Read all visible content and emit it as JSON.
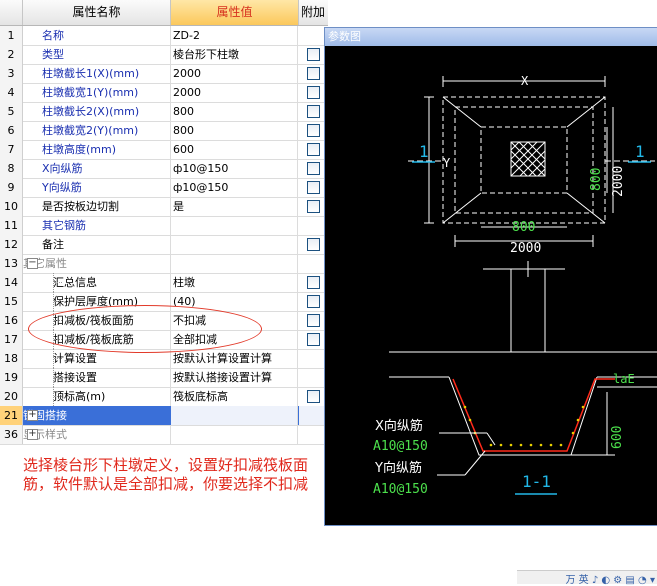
{
  "header": {
    "col_name": "属性名称",
    "col_value": "属性值",
    "col_add": "附加"
  },
  "rows": [
    {
      "num": "1",
      "name": "名称",
      "value": "ZD-2",
      "style": "blue",
      "checkbox": false
    },
    {
      "num": "2",
      "name": "类型",
      "value": "棱台形下柱墩",
      "style": "blue",
      "checkbox": true
    },
    {
      "num": "3",
      "name": "柱墩截长1(X)(mm)",
      "value": "2000",
      "style": "blue",
      "checkbox": true
    },
    {
      "num": "4",
      "name": "柱墩截宽1(Y)(mm)",
      "value": "2000",
      "style": "blue",
      "checkbox": true
    },
    {
      "num": "5",
      "name": "柱墩截长2(X)(mm)",
      "value": "800",
      "style": "blue",
      "checkbox": true
    },
    {
      "num": "6",
      "name": "柱墩截宽2(Y)(mm)",
      "value": "800",
      "style": "blue",
      "checkbox": true
    },
    {
      "num": "7",
      "name": "柱墩高度(mm)",
      "value": "600",
      "style": "blue",
      "checkbox": true
    },
    {
      "num": "8",
      "name": "X向纵筋",
      "value": "ф10@150",
      "style": "blue",
      "checkbox": true
    },
    {
      "num": "9",
      "name": "Y向纵筋",
      "value": "ф10@150",
      "style": "blue",
      "checkbox": true
    },
    {
      "num": "10",
      "name": "是否按板边切割",
      "value": "是",
      "style": "plain",
      "checkbox": true
    },
    {
      "num": "11",
      "name": "其它钢筋",
      "value": "",
      "style": "blue",
      "checkbox": false
    },
    {
      "num": "12",
      "name": "备注",
      "value": "",
      "style": "plain",
      "checkbox": true
    },
    {
      "num": "13",
      "name": "其它属性",
      "value": "",
      "style": "group",
      "toggle": "−",
      "checkbox": false
    },
    {
      "num": "14",
      "name": "汇总信息",
      "value": "柱墩",
      "style": "sub",
      "checkbox": true
    },
    {
      "num": "15",
      "name": "保护层厚度(mm)",
      "value": "(40)",
      "style": "sub",
      "checkbox": true
    },
    {
      "num": "16",
      "name": "扣减板/筏板面筋",
      "value": "不扣减",
      "style": "sub",
      "checkbox": true
    },
    {
      "num": "17",
      "name": "扣减板/筏板底筋",
      "value": "全部扣减",
      "style": "sub",
      "checkbox": true
    },
    {
      "num": "18",
      "name": "计算设置",
      "value": "按默认计算设置计算",
      "style": "sub",
      "checkbox": false
    },
    {
      "num": "19",
      "name": "搭接设置",
      "value": "按默认搭接设置计算",
      "style": "sub",
      "checkbox": false
    },
    {
      "num": "20",
      "name": "顶标高(m)",
      "value": "筏板底标高",
      "style": "sub",
      "checkbox": true
    },
    {
      "num": "21",
      "name": "锚固搭接",
      "value": "",
      "style": "selected",
      "toggle": "+",
      "checkbox": false
    },
    {
      "num": "36",
      "name": "显示样式",
      "value": "",
      "style": "group",
      "toggle": "+",
      "checkbox": false
    }
  ],
  "panel": {
    "title": "参数图"
  },
  "drawing": {
    "dim_x": "X",
    "dim_y": "Y",
    "dim_800_h": "800",
    "dim_2000_h": "2000",
    "dim_800_v": "800",
    "dim_2000_v": "2000",
    "sec_left": "1",
    "sec_right": "1",
    "lae": "laE",
    "dim_600": "600",
    "xbar_label": "X向纵筋",
    "xbar_spec": "A10@150",
    "ybar_label": "Y向纵筋",
    "ybar_spec": "A10@150",
    "section_title": "1-1",
    "colors": {
      "dim": "#ffffff",
      "green": "#4ce04c",
      "cyan": "#22b8e8",
      "red": "#ff2a1a",
      "rebar": "#e8d000"
    }
  },
  "annotation": {
    "note": "选择棱台形下柱墩定义，设置好扣减筏板面筋，软件默认是全部扣减，你要选择不扣减"
  },
  "taskbar": {
    "text": "万 英 ♪ ◐ ⚙ ▤ ◔ ▾"
  }
}
